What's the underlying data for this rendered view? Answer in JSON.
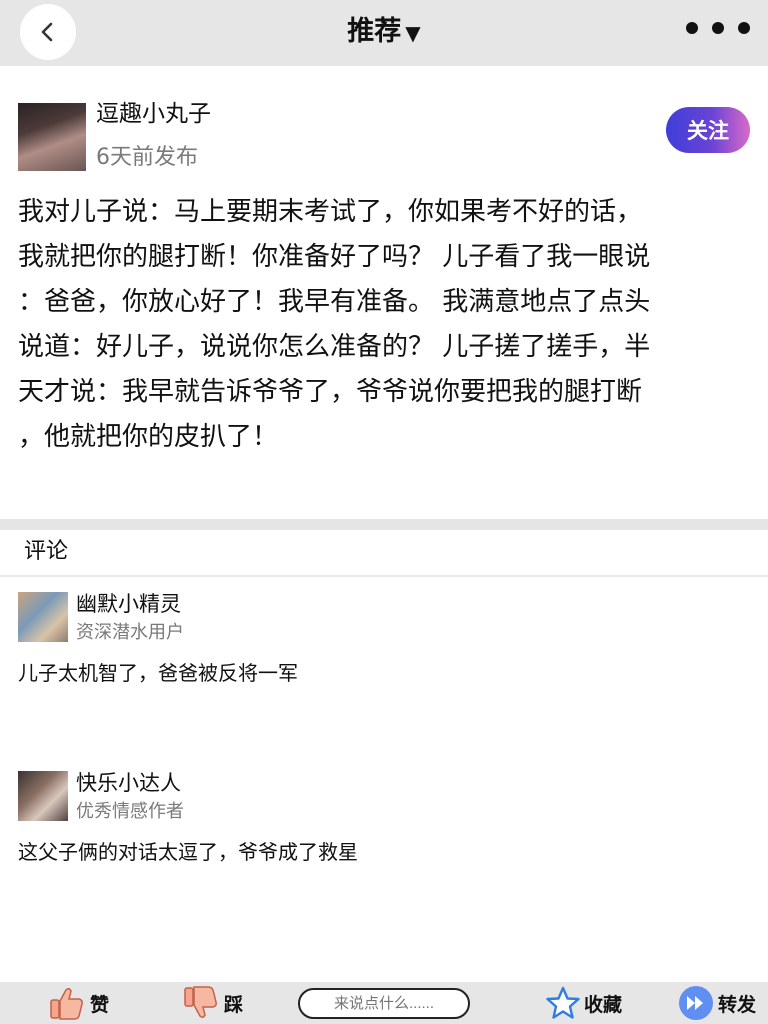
{
  "header": {
    "title": "推荐",
    "title_arrow": "▼"
  },
  "author": {
    "name": "逗趣小丸子",
    "time": "6天前发布",
    "follow_label": "关注"
  },
  "post": {
    "lines": [
      "我对儿子说：马上要期末考试了，你如果考不好的话，",
      "我就把你的腿打断！你准备好了吗？ 儿子看了我一眼说",
      "：爸爸，你放心好了！我早有准备。 我满意地点了点头",
      "说道：好儿子，说说你怎么准备的？ 儿子搓了搓手，半",
      "天才说：我早就告诉爷爷了，爷爷说你要把我的腿打断",
      "，他就把你的皮扒了！"
    ]
  },
  "comments_section": {
    "title": "评论",
    "items": [
      {
        "name": "幽默小精灵",
        "role": "资深潜水用户",
        "text": "儿子太机智了，爸爸被反将一军"
      },
      {
        "name": "快乐小达人",
        "role": "优秀情感作者",
        "text": "这父子俩的对话太逗了，爷爷成了救星"
      }
    ]
  },
  "bottom_bar": {
    "like_label": "赞",
    "dislike_label": "踩",
    "input_placeholder": "来说点什么......",
    "favorite_label": "收藏",
    "share_label": "转发"
  },
  "colors": {
    "topbar_bg": "#e6e6e6",
    "follow_gradient_start": "#3e3fd8",
    "follow_gradient_end": "#d86ac8",
    "like_icon": "#f4a58c",
    "star_icon": "#2f7de1",
    "share_icon": "#5f8ff0"
  }
}
